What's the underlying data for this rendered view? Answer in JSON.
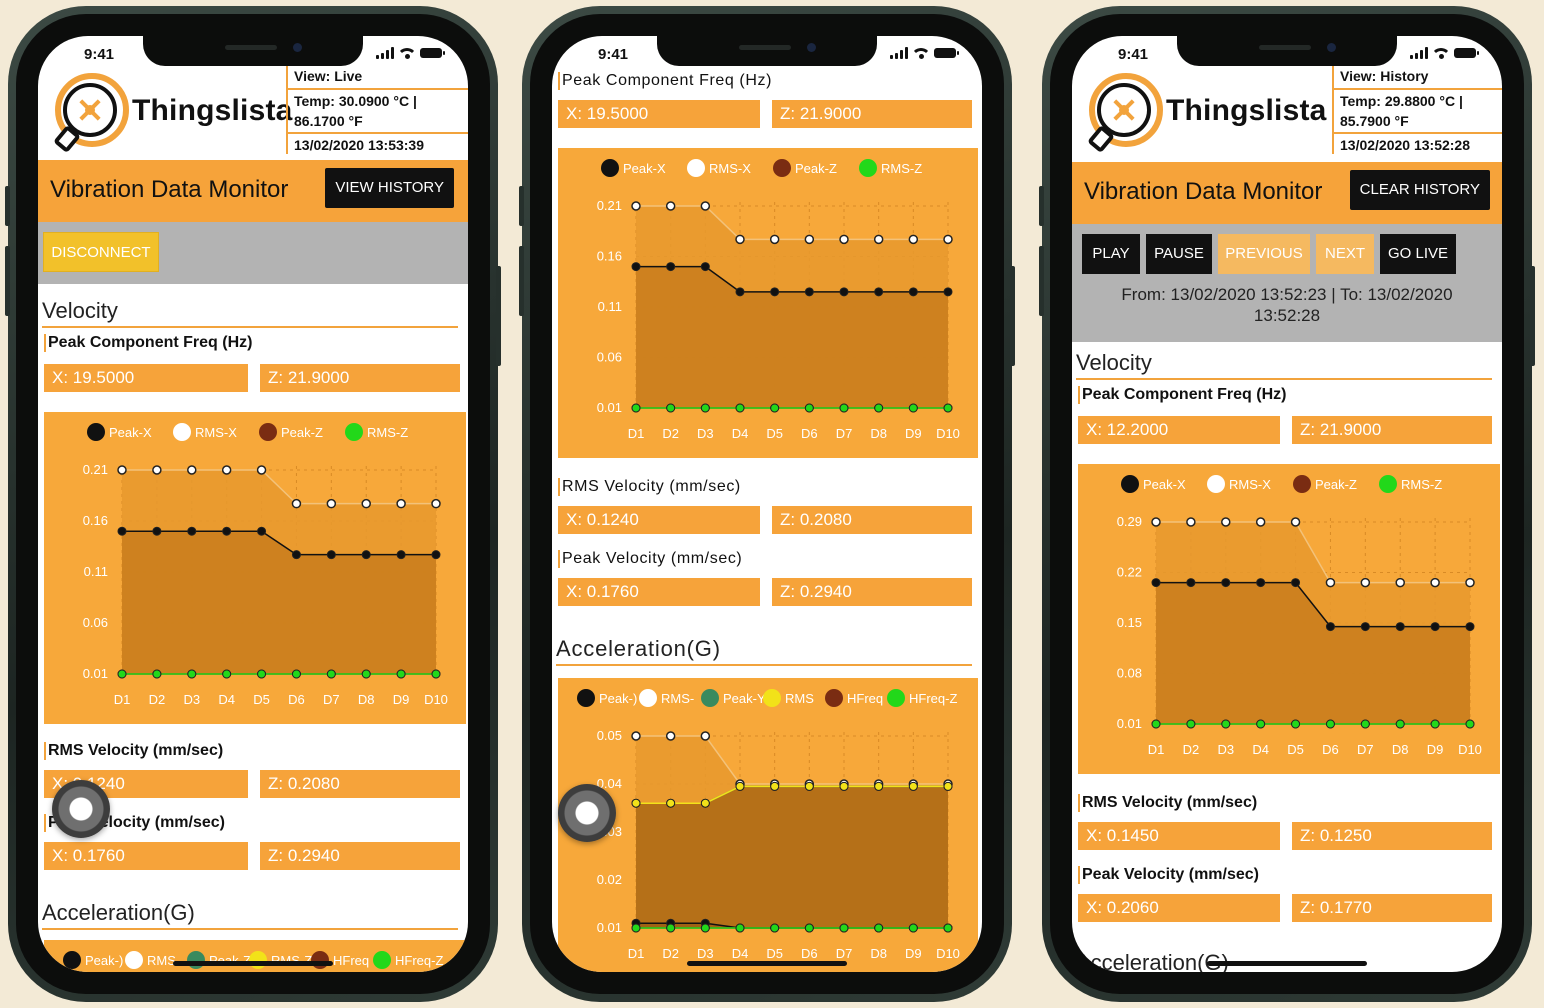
{
  "status_time": "9:41",
  "brand": {
    "name": "Thingslista"
  },
  "colors": {
    "accent": "#f6a33a",
    "chart_bg": "#f7a83a",
    "dark_button": "#111111",
    "disconnect": "#f2c12a",
    "band": "#b3b3b3",
    "peak_x": "#111111",
    "rms_x": "#ffffff",
    "peak_z": "#7a2c12",
    "rms_z": "#22d81a"
  },
  "phones": [
    {
      "header": {
        "view": "View: Live",
        "temp": "Temp: 30.0900 °C | 86.1700 °F",
        "temp_line1": "Temp: 30.0900 °C |",
        "temp_line2": "86.1700 °F",
        "timestamp": "13/02/2020 13:53:39"
      },
      "title": "Vibration Data Monitor",
      "header_button": "VIEW HISTORY",
      "disconnect_label": "DISCONNECT",
      "velocity_heading": "Velocity",
      "peak_freq_label": "Peak Component Freq (Hz)",
      "peak_freq": {
        "x": "X: 19.5000",
        "z": "Z: 21.9000"
      },
      "rms_velocity_label": "RMS Velocity (mm/sec)",
      "rms_velocity": {
        "x": "X: 0.1240",
        "z": "Z: 0.2080"
      },
      "peak_velocity_label": "Peak Velocity (mm/sec)",
      "peak_velocity": {
        "x": "X: 0.1760",
        "z": "Z: 0.2940"
      },
      "acceleration_heading": "Acceleration(G)"
    },
    {
      "peak_freq_label": "Peak Component Freq (Hz)",
      "peak_freq": {
        "x": "X: 19.5000",
        "z": "Z: 21.9000"
      },
      "rms_velocity_label": "RMS Velocity (mm/sec)",
      "rms_velocity": {
        "x": "X: 0.1240",
        "z": "Z: 0.2080"
      },
      "peak_velocity_label": "Peak Velocity (mm/sec)",
      "peak_velocity": {
        "x": "X: 0.1760",
        "z": "Z: 0.2940"
      },
      "acceleration_heading": "Acceleration(G)"
    },
    {
      "header": {
        "view": "View: History",
        "temp": "Temp: 29.8800 °C | 85.7900 °F",
        "temp_line1": "Temp: 29.8800 °C |",
        "temp_line2": "85.7900 °F",
        "timestamp": "13/02/2020 13:52:28"
      },
      "title": "Vibration Data Monitor",
      "header_button": "CLEAR HISTORY",
      "controls": {
        "play": "PLAY",
        "pause": "PAUSE",
        "previous": "PREVIOUS",
        "next": "NEXT",
        "go_live": "GO LIVE"
      },
      "range": "From: 13/02/2020 13:52:23 | To: 13/02/2020 13:52:28",
      "range_line1": "From: 13/02/2020 13:52:23 | To: 13/02/2020",
      "range_line2": "13:52:28",
      "velocity_heading": "Velocity",
      "peak_freq_label": "Peak Component Freq (Hz)",
      "peak_freq": {
        "x": "X: 12.2000",
        "z": "Z: 21.9000"
      },
      "rms_velocity_label": "RMS Velocity (mm/sec)",
      "rms_velocity": {
        "x": "X: 0.1450",
        "z": "Z: 0.1250"
      },
      "peak_velocity_label": "Peak Velocity (mm/sec)",
      "peak_velocity": {
        "x": "X: 0.2060",
        "z": "Z: 0.1770"
      },
      "acceleration_heading": "Acceleration(G)"
    }
  ],
  "chart_data": [
    {
      "type": "area",
      "chart": "phone1-velocity",
      "categories": [
        "D1",
        "D2",
        "D3",
        "D4",
        "D5",
        "D6",
        "D7",
        "D8",
        "D9",
        "D10"
      ],
      "yticks": [
        "0.21",
        "0.16",
        "0.11",
        "0.06",
        "0.01"
      ],
      "ylim": [
        0.01,
        0.21
      ],
      "legend": [
        "Peak-X",
        "RMS-X",
        "Peak-Z",
        "RMS-Z"
      ],
      "series": [
        {
          "name": "Peak-X",
          "color": "#111111",
          "values": [
            0.15,
            0.15,
            0.15,
            0.15,
            0.15,
            0.127,
            0.127,
            0.127,
            0.127,
            0.127
          ]
        },
        {
          "name": "RMS-X",
          "color": "#ffffff",
          "values": [
            0.21,
            0.21,
            0.21,
            0.21,
            0.21,
            0.177,
            0.177,
            0.177,
            0.177,
            0.177
          ]
        },
        {
          "name": "Peak-Z",
          "color": "#7a2c12",
          "values": [
            0.01,
            0.01,
            0.01,
            0.01,
            0.01,
            0.01,
            0.01,
            0.01,
            0.01,
            0.01
          ]
        },
        {
          "name": "RMS-Z",
          "color": "#22d81a",
          "values": [
            0.01,
            0.01,
            0.01,
            0.01,
            0.01,
            0.01,
            0.01,
            0.01,
            0.01,
            0.01
          ]
        }
      ]
    },
    {
      "type": "area",
      "chart": "phone2-velocity",
      "categories": [
        "D1",
        "D2",
        "D3",
        "D4",
        "D5",
        "D6",
        "D7",
        "D8",
        "D9",
        "D10"
      ],
      "yticks": [
        "0.21",
        "0.16",
        "0.11",
        "0.06",
        "0.01"
      ],
      "ylim": [
        0.01,
        0.21
      ],
      "legend": [
        "Peak-X",
        "RMS-X",
        "Peak-Z",
        "RMS-Z"
      ],
      "series": [
        {
          "name": "Peak-X",
          "color": "#111111",
          "values": [
            0.15,
            0.15,
            0.15,
            0.125,
            0.125,
            0.125,
            0.125,
            0.125,
            0.125,
            0.125
          ]
        },
        {
          "name": "RMS-X",
          "color": "#ffffff",
          "values": [
            0.21,
            0.21,
            0.21,
            0.177,
            0.177,
            0.177,
            0.177,
            0.177,
            0.177,
            0.177
          ]
        },
        {
          "name": "Peak-Z",
          "color": "#7a2c12",
          "values": [
            0.01,
            0.01,
            0.01,
            0.01,
            0.01,
            0.01,
            0.01,
            0.01,
            0.01,
            0.01
          ]
        },
        {
          "name": "RMS-Z",
          "color": "#22d81a",
          "values": [
            0.01,
            0.01,
            0.01,
            0.01,
            0.01,
            0.01,
            0.01,
            0.01,
            0.01,
            0.01
          ]
        }
      ]
    },
    {
      "type": "area",
      "chart": "phone2-acceleration",
      "categories": [
        "D1",
        "D2",
        "D3",
        "D4",
        "D5",
        "D6",
        "D7",
        "D8",
        "D9",
        "D10"
      ],
      "yticks": [
        "0.05",
        "0.04",
        "0.03",
        "0.02",
        "0.01"
      ],
      "ylim": [
        0.01,
        0.05
      ],
      "legend": [
        "Peak-X",
        "RMS-X",
        "Peak-Y",
        "RMS-Y",
        "HFreq-X",
        "HFreq-Z"
      ],
      "legend_shown": [
        "Peak-)",
        "RMS-",
        "Peak-Y",
        "RMS",
        "HFreq",
        "HFreq-Z"
      ],
      "series": [
        {
          "name": "Peak-X",
          "color": "#111111",
          "values": [
            0.011,
            0.011,
            0.011,
            0.01,
            0.01,
            0.01,
            0.01,
            0.01,
            0.01,
            0.01
          ]
        },
        {
          "name": "RMS-X",
          "color": "#ffffff",
          "values": [
            0.05,
            0.05,
            0.05,
            0.04,
            0.04,
            0.04,
            0.04,
            0.04,
            0.04,
            0.04
          ]
        },
        {
          "name": "Peak-Y",
          "color": "#3a8a5e",
          "values": [
            0.036,
            0.036,
            0.036,
            0.0395,
            0.0395,
            0.0395,
            0.0395,
            0.0395,
            0.0395,
            0.0395
          ]
        },
        {
          "name": "RMS-Y",
          "color": "#f2e219",
          "values": [
            0.036,
            0.036,
            0.036,
            0.0395,
            0.0395,
            0.0395,
            0.0395,
            0.0395,
            0.0395,
            0.0395
          ]
        },
        {
          "name": "HFreq-X",
          "color": "#7a2c12",
          "values": [
            0.01,
            0.01,
            0.01,
            0.01,
            0.01,
            0.01,
            0.01,
            0.01,
            0.01,
            0.01
          ]
        },
        {
          "name": "HFreq-Z",
          "color": "#22d81a",
          "values": [
            0.01,
            0.01,
            0.01,
            0.01,
            0.01,
            0.01,
            0.01,
            0.01,
            0.01,
            0.01
          ]
        }
      ]
    },
    {
      "type": "area",
      "chart": "phone3-velocity",
      "categories": [
        "D1",
        "D2",
        "D3",
        "D4",
        "D5",
        "D6",
        "D7",
        "D8",
        "D9",
        "D10"
      ],
      "yticks": [
        "0.29",
        "0.22",
        "0.15",
        "0.08",
        "0.01"
      ],
      "ylim": [
        0.01,
        0.29
      ],
      "legend": [
        "Peak-X",
        "RMS-X",
        "Peak-Z",
        "RMS-Z"
      ],
      "series": [
        {
          "name": "Peak-X",
          "color": "#111111",
          "values": [
            0.206,
            0.206,
            0.206,
            0.206,
            0.206,
            0.145,
            0.145,
            0.145,
            0.145,
            0.145
          ]
        },
        {
          "name": "RMS-X",
          "color": "#ffffff",
          "values": [
            0.29,
            0.29,
            0.29,
            0.29,
            0.29,
            0.206,
            0.206,
            0.206,
            0.206,
            0.206
          ]
        },
        {
          "name": "Peak-Z",
          "color": "#7a2c12",
          "values": [
            0.01,
            0.01,
            0.01,
            0.01,
            0.01,
            0.01,
            0.01,
            0.01,
            0.01,
            0.01
          ]
        },
        {
          "name": "RMS-Z",
          "color": "#22d81a",
          "values": [
            0.01,
            0.01,
            0.01,
            0.01,
            0.01,
            0.01,
            0.01,
            0.01,
            0.01,
            0.01
          ]
        }
      ]
    },
    {
      "type": "area",
      "chart": "phone1-acceleration",
      "categories": [],
      "legend": [
        "Peak-X",
        "RMS-X",
        "Peak-Y",
        "RMS-Y",
        "HFreq-X",
        "HFreq-Z"
      ],
      "legend_shown": [
        "Peak-)",
        "RMS",
        "Peak-Z",
        "RMS-Z",
        "HFreq",
        "HFreq-Z"
      ],
      "series": []
    }
  ]
}
